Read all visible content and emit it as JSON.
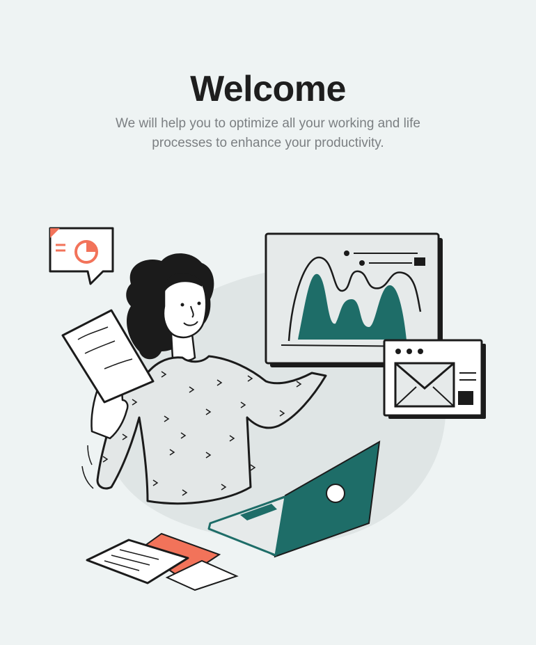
{
  "welcome": {
    "title": "Welcome",
    "subtitle": "We will help you to optimize all your working and life processes to enhance your productivity."
  },
  "colors": {
    "background": "#eef3f3",
    "accent_teal": "#1e6d68",
    "accent_coral": "#f2735a",
    "outline": "#1b1b1b",
    "shirt": "#e3e7e7"
  },
  "illustration": {
    "subject": "person-working-with-devices",
    "icons": [
      "chat-bubble-chart-icon",
      "dashboard-chart-window",
      "mail-window-icon",
      "laptop-icon",
      "document-icon"
    ]
  }
}
